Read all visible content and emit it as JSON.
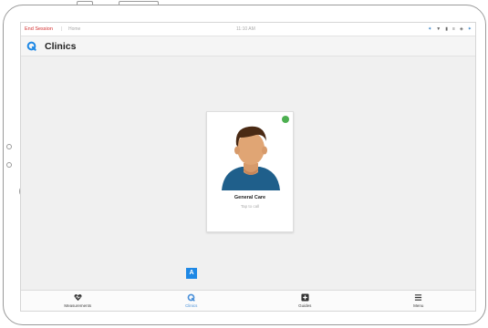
{
  "status_bar": {
    "end_session": "End Session",
    "separator": "|",
    "home": "Home",
    "time": "11:10 AM",
    "icons": [
      "bluetooth-icon",
      "wifi-icon",
      "battery-icon",
      "signal-icon",
      "volume-icon",
      "bluetooth-connected-icon"
    ]
  },
  "header": {
    "title": "Clinics",
    "logo": "clinic-logo-icon"
  },
  "clinic_card": {
    "title": "General Care",
    "subtitle": "Tap to call",
    "status": "online",
    "status_color": "#4caf50"
  },
  "callout": {
    "label": "A"
  },
  "bottom_nav": {
    "items": [
      {
        "label": "Measurements",
        "icon": "heart-pulse-icon"
      },
      {
        "label": "Clinics",
        "icon": "clinic-icon",
        "active": true
      },
      {
        "label": "Guides",
        "icon": "medical-kit-icon"
      },
      {
        "label": "Menu",
        "icon": "hamburger-menu-icon"
      }
    ]
  },
  "colors": {
    "accent": "#4a90d9",
    "end_session": "#d32f2f",
    "callout": "#1e88e5"
  }
}
